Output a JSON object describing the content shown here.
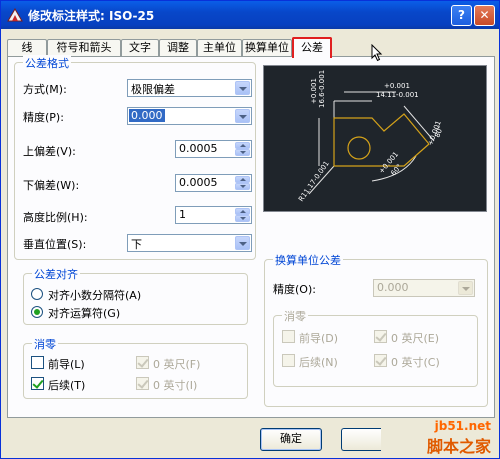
{
  "window": {
    "title": "修改标注样式: ISO-25"
  },
  "tabs": [
    {
      "label": "线"
    },
    {
      "label": "符号和箭头"
    },
    {
      "label": "文字"
    },
    {
      "label": "调整"
    },
    {
      "label": "主单位"
    },
    {
      "label": "换算单位"
    },
    {
      "label": "公差"
    }
  ],
  "active_tab": "公差",
  "tolerance_format": {
    "title": "公差格式",
    "method_label": "方式(M):",
    "method_value": "极限偏差",
    "precision_label": "精度(P):",
    "precision_value": "0.000",
    "upper_label": "上偏差(V):",
    "upper_value": "0.0005",
    "lower_label": "下偏差(W):",
    "lower_value": "0.0005",
    "height_label": "高度比例(H):",
    "height_value": "1",
    "vpos_label": "垂直位置(S):",
    "vpos_value": "下"
  },
  "tolerance_alignment": {
    "title": "公差对齐",
    "opt1": "对齐小数分隔符(A)",
    "opt2": "对齐运算符(G)",
    "selected": "对齐运算符(G)"
  },
  "zero_suppression": {
    "title": "消零",
    "leading": "前导(L)",
    "leading_checked": false,
    "trailing": "后续(T)",
    "trailing_checked": true,
    "zero_feet": "0 英尺(F)",
    "zero_inches": "0 英寸(I)"
  },
  "alt_unit_tolerance": {
    "title": "换算单位公差",
    "precision_label": "精度(O):",
    "precision_value": "0.000",
    "zero_title": "消零",
    "leading": "前导(D)",
    "trailing": "后续(N)",
    "zero_feet": "0 英尺(E)",
    "zero_inches": "0 英寸(C)"
  },
  "preview_labels": {
    "t1": "+0.001",
    "t2": "14.11-0.001",
    "t3": "+0.001",
    "t4": "16.6-0.001",
    "t5": "R11.17-0.001",
    "t6": "+0.001",
    "t7": "60°",
    "t8": "+0.001",
    "t9": "80°"
  },
  "buttons": {
    "ok": "确定"
  },
  "watermark": {
    "url": "jb51.net",
    "name": "脚本之家"
  },
  "colors": {
    "accent": "#e02020",
    "selection": "#316ac5",
    "group_title": "#0046d5"
  }
}
